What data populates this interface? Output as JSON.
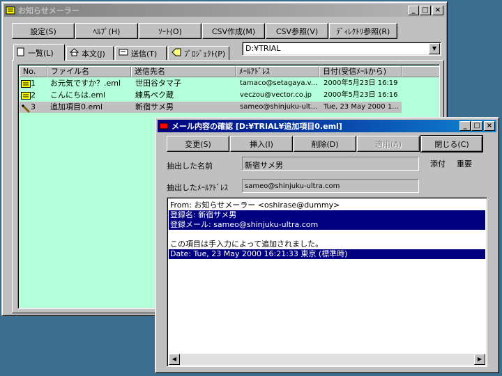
{
  "main": {
    "title": "お知らせメーラー",
    "toolbar": [
      "設定(S)",
      "ﾍﾙﾌﾟ(H)",
      "ｿｰﾄ(O)",
      "CSV作成(M)",
      "CSV参照(V)",
      "ﾃﾞｨﾚｸﾄﾘ参照(R)"
    ],
    "tabs": [
      "一覧(L)",
      "本文(J)",
      "送信(T)",
      "ﾌﾟﾛｼﾞｪｸﾄ(P)"
    ],
    "path": "D:¥TRIAL",
    "columns": [
      "No.",
      "ファイル名",
      "送信先名",
      "ﾒｰﾙｱﾄﾞﾚｽ",
      "日付(受信ﾒｰﾙから)"
    ],
    "rows": [
      {
        "no": "1",
        "file": "お元気ですか？.eml",
        "name": "世田谷タマ子",
        "addr": "tamaco@setagaya.v...",
        "date": "2000年5月23日 16:19",
        "icon": "mail-icon"
      },
      {
        "no": "2",
        "file": "こんにちは.eml",
        "name": "練馬ペク蔵",
        "addr": "veczou@vector.co.jp",
        "date": "2000年5月23日 16:16",
        "icon": "mail-icon"
      },
      {
        "no": "3",
        "file": "追加項目0.eml",
        "name": "新宿サメ男",
        "addr": "sameo@shinjuku-ult...",
        "date": "Tue, 23 May 2000 1...",
        "icon": "pencil-icon"
      }
    ]
  },
  "dialog": {
    "title": "メール内容の確認 [D:¥TRIAL¥追加項目0.eml]",
    "buttons": [
      "変更(S)",
      "挿入(I)",
      "削除(D)",
      "適用(A)",
      "閉じる(C)"
    ],
    "name_label": "抽出した名前",
    "name_value": "新宿サメ男",
    "attach_label": "添付",
    "important_label": "重要",
    "addr_label": "抽出したﾒｰﾙｱﾄﾞﾚｽ",
    "addr_value": "sameo@shinjuku-ultra.com",
    "lines": [
      "From: お知らせメーラー <oshirase@dummy>",
      "登録名: 新宿サメ男",
      "登録メール: sameo@shinjuku-ultra.com",
      "",
      "この項目は手入力によって追加されました。",
      "Date: Tue, 23 May 2000 16:21:33 東京 (標準時)"
    ]
  },
  "colors": {
    "list_bg": "#b3ffd9",
    "titlebar_active": "#000080",
    "titlebar_inactive": "#808080",
    "desktop": "#3b6e8f"
  }
}
